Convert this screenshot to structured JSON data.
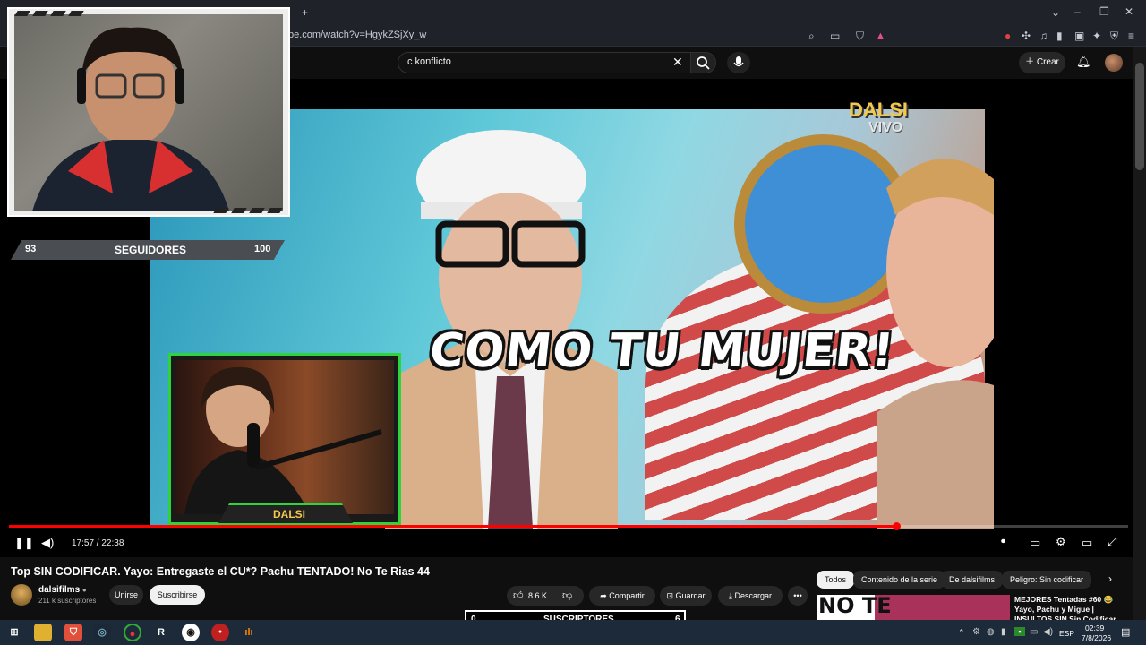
{
  "browser": {
    "url": "be.com/watch?v=HgykZSjXy_w",
    "new_tab": "+"
  },
  "youtube": {
    "search_query": "c konflicto",
    "create_label": "Crear"
  },
  "overlay": {
    "followers_current": "93",
    "followers_label": "SEGUIDORES",
    "followers_goal": "100",
    "guest_label": "DALSI",
    "subs_current": "0",
    "subs_label": "SUSCRIPTORES",
    "subs_goal": "6"
  },
  "video": {
    "caption": "COMO TU MUJER!",
    "logo": "DALSI",
    "logo_sub": "VIVO",
    "time": "17:57 / 22:38",
    "progress": 0.793
  },
  "info": {
    "title": "Top SIN CODIFICAR. Yayo: Entregaste el CU*? Pachu TENTADO! No Te Rias 44",
    "channel": "dalsifilms",
    "subscribers": "211 k suscriptores",
    "join": "Unirse",
    "subscribe": "Suscribirse",
    "likes": "8.6 K",
    "share": "Compartir",
    "save": "Guardar",
    "download": "Descargar"
  },
  "chips": [
    "Todos",
    "Contenido de la serie",
    "De dalsifilms",
    "Peligro: Sin codificar"
  ],
  "recommended": {
    "thumb_text": "NO TE",
    "title": "MEJORES Tentadas #60 😂 Yayo, Pachu y Migue | INSULTOS SIN Sin Codificar"
  },
  "taskbar": {
    "lang": "ESP",
    "time": "02:39",
    "date": "7/8/2026"
  },
  "colors": {
    "accent": "#ff0000",
    "overlay_green": "#2fd33a",
    "logo_gold": "#f2c94c"
  }
}
